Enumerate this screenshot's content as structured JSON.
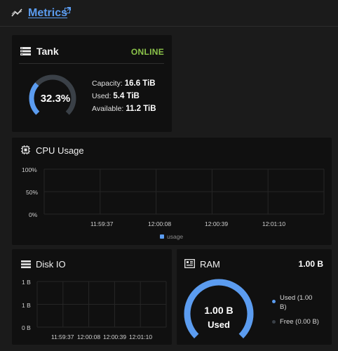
{
  "header": {
    "title": "Metrics"
  },
  "tank": {
    "title": "Tank",
    "status": "ONLINE",
    "usage_percent_label": "32.3%",
    "usage_fraction": 0.323,
    "capacity_label": "Capacity:",
    "capacity_value": "16.6 TiB",
    "used_label": "Used:",
    "used_value": "5.4 TiB",
    "available_label": "Available:",
    "available_value": "11.2 TiB",
    "colors": {
      "status": "#8bc34a",
      "gauge": "#5b9cf0",
      "track": "#3a4047"
    }
  },
  "cpu": {
    "title": "CPU Usage",
    "y_ticks": [
      "100%",
      "50%",
      "0%"
    ],
    "x_ticks": [
      "11:59:37",
      "12:00:08",
      "12:00:39",
      "12:01:10"
    ],
    "legend": "usage"
  },
  "disk": {
    "title": "Disk IO",
    "y_ticks": [
      "1 B",
      "1 B",
      "0 B"
    ],
    "x_ticks": [
      "11:59:37",
      "12:00:08",
      "12:00:39",
      "12:01:10"
    ]
  },
  "ram": {
    "title": "RAM",
    "total": "1.00 B",
    "gauge_value": "1.00 B",
    "gauge_caption": "Used",
    "used_fraction": 1.0,
    "legend_used_line1": "Used (1.00",
    "legend_used_line2": "B)",
    "legend_free": "Free (0.00 B)",
    "colors": {
      "used": "#5b9cf0",
      "free": "#3a4047"
    }
  },
  "chart_data": [
    {
      "type": "line",
      "title": "CPU Usage",
      "x": [
        "11:59:37",
        "12:00:08",
        "12:00:39",
        "12:01:10"
      ],
      "series": [
        {
          "name": "usage",
          "values": []
        }
      ],
      "ylim": [
        0,
        100
      ],
      "yticks": [
        "100%",
        "50%",
        "0%"
      ],
      "grid": true,
      "legend": "bottom"
    },
    {
      "type": "line",
      "title": "Disk IO",
      "x": [
        "11:59:37",
        "12:00:08",
        "12:00:39",
        "12:01:10"
      ],
      "series": [],
      "yticks": [
        "1 B",
        "1 B",
        "0 B"
      ],
      "grid": true
    }
  ]
}
